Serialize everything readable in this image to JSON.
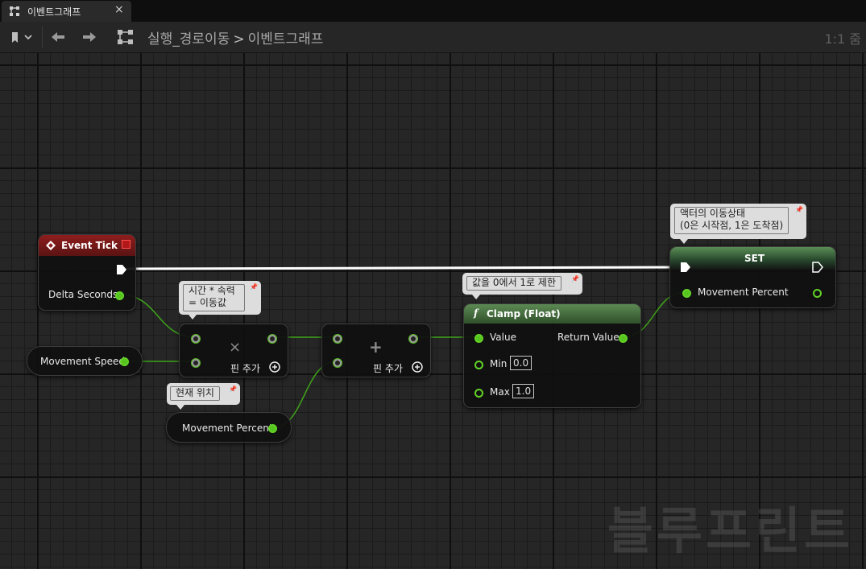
{
  "tab": {
    "title": "이벤트그래프",
    "close": "×",
    "icon": "graph-icon"
  },
  "toolbar": {
    "breadcrumb": [
      "실행_경로이동",
      "이벤트그래프"
    ],
    "separator": ">",
    "zoom": "1:1 줌",
    "icons": [
      "bookmark-icon",
      "back-icon",
      "forward-icon",
      "graph-icon"
    ]
  },
  "nodes": {
    "event_tick": {
      "title": "Event Tick",
      "out_pin": "Delta Seconds",
      "header_color": "#8a1b1b"
    },
    "movement_speed": {
      "label": "Movement Speed"
    },
    "multiply": {
      "symbol": "×",
      "add_pin": "핀 추가"
    },
    "add": {
      "symbol": "+",
      "add_pin": "핀 추가"
    },
    "movement_percent_get": {
      "label": "Movement Percent"
    },
    "clamp": {
      "title": "Clamp (Float)",
      "func_icon": "f",
      "value": "Value",
      "return_value": "Return Value",
      "min_label": "Min",
      "min": "0.0",
      "max_label": "Max",
      "max": "1.0",
      "header_color": "#4f7a48"
    },
    "set": {
      "title": "SET",
      "pin": "Movement Percent",
      "header_color": "#3a6a3a"
    }
  },
  "comments": {
    "multiply": "시간 * 속력\n= 이동값",
    "current": "현재 위치",
    "clamp": "값을 0에서 1로 제한",
    "set": "액터의 이동상태\n(0은 시작점, 1은 도착점)"
  },
  "watermark": "블루프린트",
  "colors": {
    "float_pin": "#57c41f",
    "exec_wire": "#ffffff",
    "grid_bg": "#262626"
  }
}
